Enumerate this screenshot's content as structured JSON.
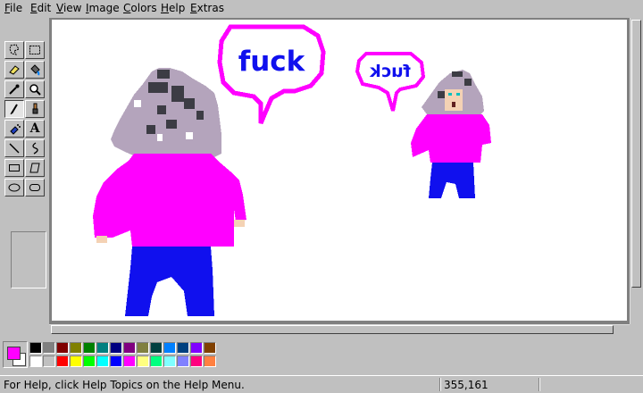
{
  "menubar": {
    "items": [
      {
        "label": "File",
        "u": "F",
        "rest": "ile"
      },
      {
        "label": "Edit",
        "u": "E",
        "rest": "dit"
      },
      {
        "label": "View",
        "u": "V",
        "rest": "iew"
      },
      {
        "label": "Image",
        "u": "I",
        "rest": "mage"
      },
      {
        "label": "Colors",
        "u": "C",
        "rest": "olors"
      },
      {
        "label": "Help",
        "u": "H",
        "rest": "elp"
      },
      {
        "label": "Extras",
        "u": "E",
        "rest": "xtras"
      }
    ]
  },
  "toolbox": {
    "tools": [
      {
        "name": "free-select-tool",
        "glyph": "⋰",
        "icon": "free-form-select-icon"
      },
      {
        "name": "rect-select-tool",
        "glyph": "⬚",
        "icon": "rectangle-select-icon"
      },
      {
        "name": "eraser-tool",
        "glyph": "⌫",
        "icon": "eraser-icon"
      },
      {
        "name": "fill-tool",
        "glyph": "🪣",
        "icon": "fill-bucket-icon"
      },
      {
        "name": "color-picker-tool",
        "glyph": "✒",
        "icon": "eyedropper-icon"
      },
      {
        "name": "magnifier-tool",
        "glyph": "🔍",
        "icon": "magnifier-icon"
      },
      {
        "name": "pencil-tool",
        "glyph": "✎",
        "icon": "pencil-icon"
      },
      {
        "name": "brush-tool",
        "glyph": "🖌",
        "icon": "brush-icon"
      },
      {
        "name": "airbrush-tool",
        "glyph": "✱",
        "icon": "airbrush-icon"
      },
      {
        "name": "text-tool",
        "glyph": "A",
        "icon": "text-icon"
      },
      {
        "name": "line-tool",
        "glyph": "╲",
        "icon": "line-icon"
      },
      {
        "name": "curve-tool",
        "glyph": "∫",
        "icon": "curve-icon"
      },
      {
        "name": "rectangle-tool",
        "glyph": "▭",
        "icon": "rectangle-icon"
      },
      {
        "name": "polygon-tool",
        "glyph": "⏢",
        "icon": "polygon-icon"
      },
      {
        "name": "ellipse-tool",
        "glyph": "⬭",
        "icon": "ellipse-icon"
      },
      {
        "name": "rounded-rect-tool",
        "glyph": "▢",
        "icon": "rounded-rectangle-icon"
      }
    ],
    "active_tool": "pencil-tool"
  },
  "canvas": {
    "speech_large": "fuck",
    "speech_small": "fuck",
    "colors": {
      "magenta": "#ff00ff",
      "blue": "#1010ee",
      "hair_light": "#b4a4bc",
      "hair_dark": "#3c3c44",
      "skin": "#f4d2b4",
      "text_blue": "#1010ee"
    }
  },
  "palette": {
    "foreground": "#ff00ff",
    "background": "#ffffff",
    "row1": [
      "#000000",
      "#808080",
      "#800000",
      "#808000",
      "#008000",
      "#008080",
      "#000080",
      "#800080",
      "#808040",
      "#004040",
      "#0080ff",
      "#004080",
      "#8000ff",
      "#804000"
    ],
    "row2": [
      "#ffffff",
      "#c0c0c0",
      "#ff0000",
      "#ffff00",
      "#00ff00",
      "#00ffff",
      "#0000ff",
      "#ff00ff",
      "#ffff80",
      "#00ff80",
      "#80ffff",
      "#8080ff",
      "#ff0080",
      "#ff8040"
    ]
  },
  "statusbar": {
    "help_text": "For Help, click Help Topics on the Help Menu.",
    "coords": "355,161"
  }
}
